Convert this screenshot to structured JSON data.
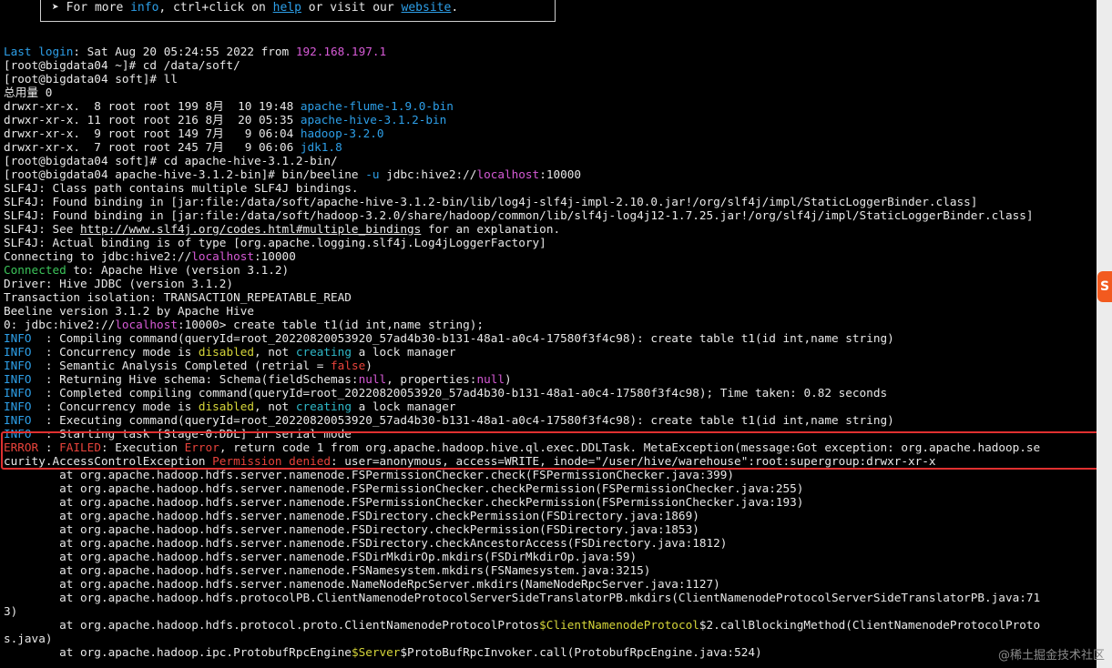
{
  "banner": {
    "prefix": "➤ For more ",
    "link1": "info",
    "middle": ", ctrl+click on ",
    "link2": "help",
    "mid2": " or visit our ",
    "link3": "website",
    "suffix": "."
  },
  "lines": [
    [
      {
        "t": "Last login",
        "c": "blue"
      },
      {
        "t": ": Sat Aug 20 05:24:55 2022 from "
      },
      {
        "t": "192.168.197.1",
        "c": "mag"
      }
    ],
    [
      {
        "t": "[root@bigdata04 ~]# cd /data/soft/"
      }
    ],
    [
      {
        "t": "[root@bigdata04 soft]# ll"
      }
    ],
    [
      {
        "t": "总用量 0"
      }
    ],
    [
      {
        "t": "drwxr-xr-x.  8 root root 199 8月  10 19:48 "
      },
      {
        "t": "apache-flume-1.9.0-bin",
        "c": "blue"
      }
    ],
    [
      {
        "t": "drwxr-xr-x. 11 root root 216 8月  20 05:35 "
      },
      {
        "t": "apache-hive-3.1.2-bin",
        "c": "blue"
      }
    ],
    [
      {
        "t": "drwxr-xr-x.  9 root root 149 7月   9 06:04 "
      },
      {
        "t": "hadoop-3.2.0",
        "c": "blue"
      }
    ],
    [
      {
        "t": "drwxr-xr-x.  7 root root 245 7月   9 06:06 "
      },
      {
        "t": "jdk1.8",
        "c": "blue"
      }
    ],
    [
      {
        "t": "[root@bigdata04 soft]# cd apache-hive-3.1.2-bin/"
      }
    ],
    [
      {
        "t": "[root@bigdata04 apache-hive-3.1.2-bin]# bin/beeline "
      },
      {
        "t": "-u",
        "c": "blue"
      },
      {
        "t": " jdbc:hive2://"
      },
      {
        "t": "localhost",
        "c": "mag"
      },
      {
        "t": ":10000"
      }
    ],
    [
      {
        "t": "SLF4J: Class path contains multiple SLF4J bindings."
      }
    ],
    [
      {
        "t": "SLF4J: Found binding in [jar:file:/data/soft/apache-hive-3.1.2-bin/lib/log4j-slf4j-impl-2.10.0.jar!/org/slf4j/impl/StaticLoggerBinder.class]"
      }
    ],
    [
      {
        "t": "SLF4J: Found binding in [jar:file:/data/soft/hadoop-3.2.0/share/hadoop/common/lib/slf4j-log4j12-1.7.25.jar!/org/slf4j/impl/StaticLoggerBinder.class]"
      }
    ],
    [
      {
        "t": "SLF4J: See "
      },
      {
        "t": "http://www.slf4j.org/codes.html#multiple_bindings",
        "c": "ul"
      },
      {
        "t": " for an explanation."
      }
    ],
    [
      {
        "t": "SLF4J: Actual binding is of type [org.apache.logging.slf4j.Log4jLoggerFactory]"
      }
    ],
    [
      {
        "t": "Connecting to jdbc:hive2://"
      },
      {
        "t": "localhost",
        "c": "mag"
      },
      {
        "t": ":10000"
      }
    ],
    [
      {
        "t": "Connected",
        "c": "grn"
      },
      {
        "t": " to: Apache Hive (version 3.1.2)"
      }
    ],
    [
      {
        "t": "Driver: Hive JDBC (version 3.1.2)"
      }
    ],
    [
      {
        "t": "Transaction isolation: TRANSACTION_REPEATABLE_READ"
      }
    ],
    [
      {
        "t": "Beeline version 3.1.2 by Apache Hive"
      }
    ],
    [
      {
        "t": "0: jdbc:hive2://"
      },
      {
        "t": "localhost",
        "c": "mag"
      },
      {
        "t": ":10000> create table t1(id int,name string);"
      }
    ],
    [
      {
        "t": "INFO ",
        "c": "blue"
      },
      {
        "t": " : Compiling command(queryId=root_20220820053920_57ad4b30-b131-48a1-a0c4-17580f3f4c98): create table t1(id int,name string)"
      }
    ],
    [
      {
        "t": "INFO ",
        "c": "blue"
      },
      {
        "t": " : Concurrency mode is "
      },
      {
        "t": "disabled",
        "c": "ylw"
      },
      {
        "t": ", not "
      },
      {
        "t": "creating",
        "c": "cyan"
      },
      {
        "t": " a lock manager"
      }
    ],
    [
      {
        "t": "INFO ",
        "c": "blue"
      },
      {
        "t": " : Semantic Analysis Completed (retrial = "
      },
      {
        "t": "false",
        "c": "red"
      },
      {
        "t": ")"
      }
    ],
    [
      {
        "t": "INFO ",
        "c": "blue"
      },
      {
        "t": " : Returning Hive schema: Schema(fieldSchemas:"
      },
      {
        "t": "null",
        "c": "mag"
      },
      {
        "t": ", properties:"
      },
      {
        "t": "null",
        "c": "mag"
      },
      {
        "t": ")"
      }
    ],
    [
      {
        "t": "INFO ",
        "c": "blue"
      },
      {
        "t": " : Completed compiling command(queryId=root_20220820053920_57ad4b30-b131-48a1-a0c4-17580f3f4c98); Time taken: 0.82 seconds"
      }
    ],
    [
      {
        "t": "INFO ",
        "c": "blue"
      },
      {
        "t": " : Concurrency mode is "
      },
      {
        "t": "disabled",
        "c": "ylw"
      },
      {
        "t": ", not "
      },
      {
        "t": "creating",
        "c": "cyan"
      },
      {
        "t": " a lock manager"
      }
    ],
    [
      {
        "t": "INFO ",
        "c": "blue"
      },
      {
        "t": " : Executing command(queryId=root_20220820053920_57ad4b30-b131-48a1-a0c4-17580f3f4c98): create table t1(id int,name string)"
      }
    ],
    [
      {
        "t": "INFO ",
        "c": "blue"
      },
      {
        "t": " : Starting task [Stage-0:DDL] in serial mode"
      }
    ],
    [
      {
        "t": "ERROR",
        "c": "red"
      },
      {
        "t": " : "
      },
      {
        "t": "FAILED",
        "c": "red"
      },
      {
        "t": ": Execution "
      },
      {
        "t": "Error",
        "c": "red"
      },
      {
        "t": ", return code 1 from org.apache.hadoop.hive.ql.exec.DDLTask. MetaException(message:Got exception: org.apache.hadoop.se"
      }
    ],
    [
      {
        "t": "curity.AccessControlException "
      },
      {
        "t": "Permission denied",
        "c": "red"
      },
      {
        "t": ": user=anonymous, access=WRITE, inode=\"/user/hive/warehouse\":root:supergroup:drwxr-xr-x"
      }
    ],
    [
      {
        "t": "        at org.apache.hadoop.hdfs.server.namenode.FSPermissionChecker.check(FSPermissionChecker.java:399)"
      }
    ],
    [
      {
        "t": "        at org.apache.hadoop.hdfs.server.namenode.FSPermissionChecker.checkPermission(FSPermissionChecker.java:255)"
      }
    ],
    [
      {
        "t": "        at org.apache.hadoop.hdfs.server.namenode.FSPermissionChecker.checkPermission(FSPermissionChecker.java:193)"
      }
    ],
    [
      {
        "t": "        at org.apache.hadoop.hdfs.server.namenode.FSDirectory.checkPermission(FSDirectory.java:1869)"
      }
    ],
    [
      {
        "t": "        at org.apache.hadoop.hdfs.server.namenode.FSDirectory.checkPermission(FSDirectory.java:1853)"
      }
    ],
    [
      {
        "t": "        at org.apache.hadoop.hdfs.server.namenode.FSDirectory.checkAncestorAccess(FSDirectory.java:1812)"
      }
    ],
    [
      {
        "t": "        at org.apache.hadoop.hdfs.server.namenode.FSDirMkdirOp.mkdirs(FSDirMkdirOp.java:59)"
      }
    ],
    [
      {
        "t": "        at org.apache.hadoop.hdfs.server.namenode.FSNamesystem.mkdirs(FSNamesystem.java:3215)"
      }
    ],
    [
      {
        "t": "        at org.apache.hadoop.hdfs.server.namenode.NameNodeRpcServer.mkdirs(NameNodeRpcServer.java:1127)"
      }
    ],
    [
      {
        "t": "        at org.apache.hadoop.hdfs.protocolPB.ClientNamenodeProtocolServerSideTranslatorPB.mkdirs(ClientNamenodeProtocolServerSideTranslatorPB.java:71"
      }
    ],
    [
      {
        "t": "3)"
      }
    ],
    [
      {
        "t": "        at org.apache.hadoop.hdfs.protocol.proto.ClientNamenodeProtocolProtos"
      },
      {
        "t": "$ClientNamenodeProtocol",
        "c": "ylw"
      },
      {
        "t": "$2.callBlockingMethod(ClientNamenodeProtocolProto"
      }
    ],
    [
      {
        "t": "s.java)"
      }
    ],
    [
      {
        "t": "        at org.apache.hadoop.ipc.ProtobufRpcEngine"
      },
      {
        "t": "$Server",
        "c": "ylw"
      },
      {
        "t": "$ProtoBufRpcInvoker.call(ProtobufRpcEngine.java:524)"
      }
    ]
  ],
  "badge": "S",
  "watermark": "@稀土掘金技术社区"
}
